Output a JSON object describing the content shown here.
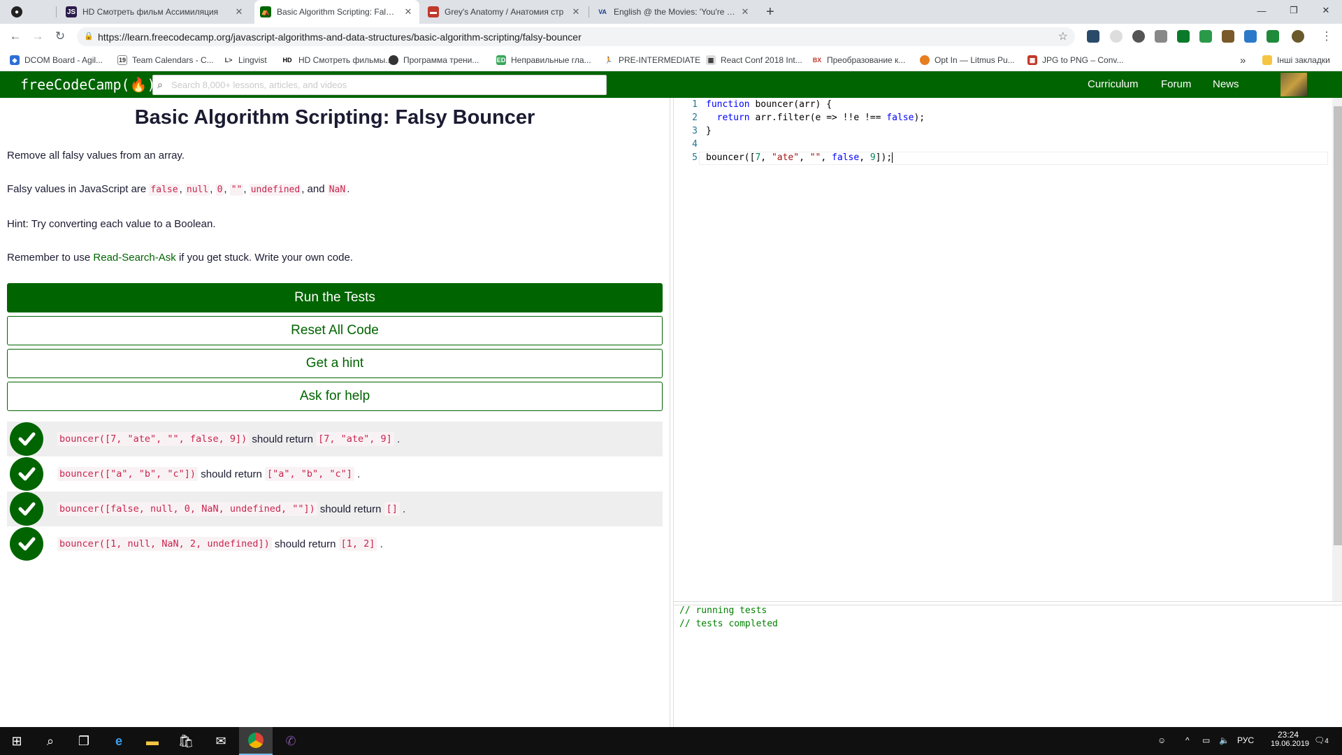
{
  "browser": {
    "tabs": [
      {
        "title": "",
        "icon": "github-icon"
      },
      {
        "title": "HD Смотреть фильм Ассимиляция",
        "icon": "js-icon"
      },
      {
        "title": "Basic Algorithm Scripting: Falsy B",
        "icon": "freecodecamp-icon",
        "active": true
      },
      {
        "title": "Grey's Anatomy / Анатомия стр",
        "icon": "grey-icon"
      },
      {
        "title": "English @ the Movies: 'You're a L",
        "icon": "va-icon"
      }
    ],
    "new_tab": "+",
    "url": "https://learn.freecodecamp.org/javascript-algorithms-and-data-structures/basic-algorithm-scripting/falsy-bouncer",
    "bookmarks": [
      "DCOM Board - Agil...",
      "Team Calendars - C...",
      "Lingvist",
      "HD Смотреть фильмы...",
      "Программа трени...",
      "Неправильные гла...",
      "PRE-INTERMEDIATE",
      "React Conf 2018 Int...",
      "Преобразование к...",
      "Opt In — Litmus Pu...",
      "JPG to PNG – Conv..."
    ],
    "bookmarks_more": "»",
    "other_bookmarks": "Інші закладки"
  },
  "fcc": {
    "logo": "freeCodeCamp(🔥)",
    "search_placeholder": "Search 8,000+ lessons, articles, and videos",
    "nav": [
      "Curriculum",
      "Forum",
      "News"
    ]
  },
  "challenge": {
    "title": "Basic Algorithm Scripting: Falsy Bouncer",
    "p1": "Remove all falsy values from an array.",
    "p2_prefix": "Falsy values in JavaScript are ",
    "falsy": [
      "false",
      "null",
      "0",
      "\"\"",
      "undefined",
      "NaN"
    ],
    "p2_and": "and",
    "p3": "Hint: Try converting each value to a Boolean.",
    "p4_prefix": "Remember to use ",
    "p4_link": "Read-Search-Ask",
    "p4_suffix": " if you get stuck. Write your own code.",
    "buttons": {
      "run": "Run the Tests",
      "reset": "Reset All Code",
      "hint": "Get a hint",
      "help": "Ask for help"
    },
    "tests": [
      {
        "call": "bouncer([7, \"ate\", \"\", false, 9])",
        "mid": "should return",
        "result": "[7, \"ate\", 9]",
        "passed": true
      },
      {
        "call": "bouncer([\"a\", \"b\", \"c\"])",
        "mid": "should return",
        "result": "[\"a\", \"b\", \"c\"]",
        "passed": true
      },
      {
        "call": "bouncer([false, null, 0, NaN, undefined, \"\"])",
        "mid": "should return",
        "result": "[]",
        "passed": true
      },
      {
        "call": "bouncer([1, null, NaN, 2, undefined])",
        "mid": "should return",
        "result": "[1, 2]",
        "passed": true
      }
    ]
  },
  "editor": {
    "line_numbers": [
      "1",
      "2",
      "3",
      "4",
      "5"
    ],
    "output": [
      "// running tests",
      "// tests completed"
    ]
  },
  "taskbar": {
    "lang": "РУС",
    "time": "23:24",
    "date": "19.06.2019",
    "notifications": "4"
  }
}
